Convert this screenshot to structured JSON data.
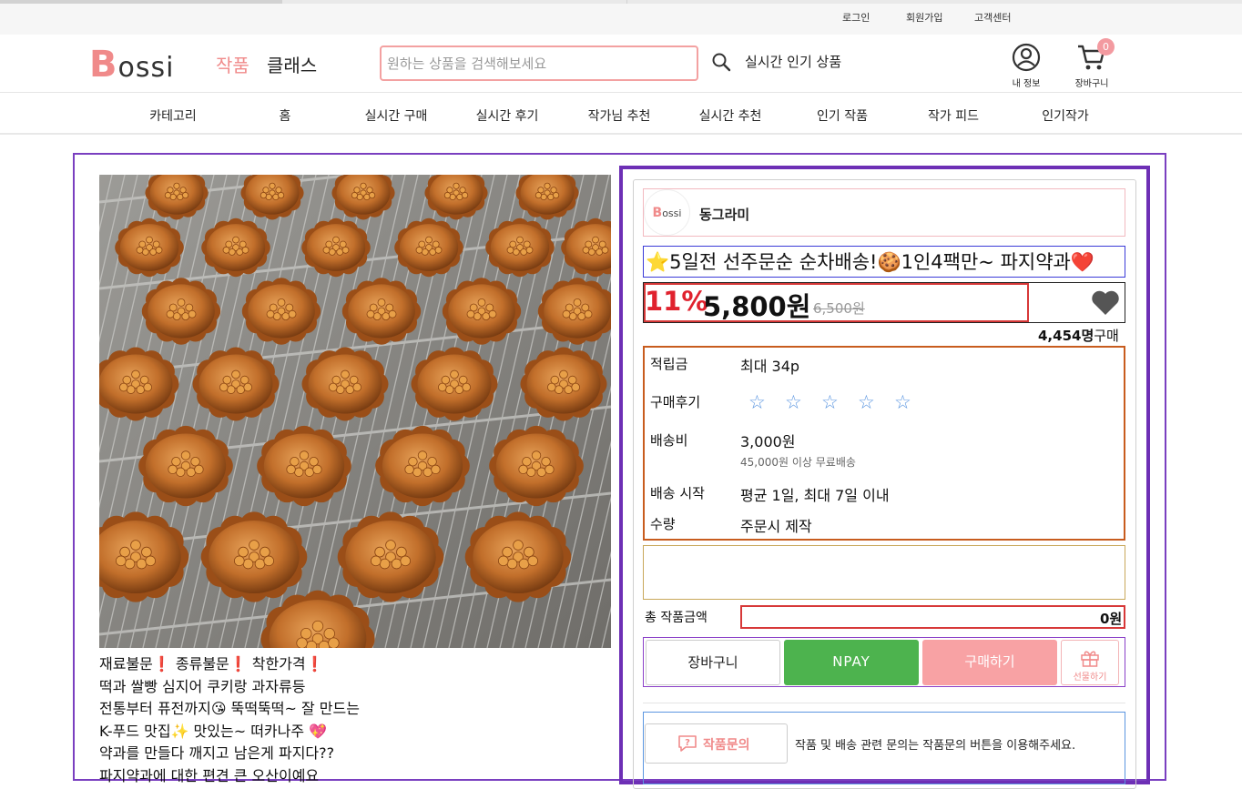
{
  "util_nav": {
    "login": "로그인",
    "signup": "회원가입",
    "support": "고객센터"
  },
  "header": {
    "logo_b": "B",
    "logo_rest": "ossi",
    "tab_works": "작품",
    "tab_class": "클래스",
    "search_placeholder": "원하는 상품을 검색해보세요",
    "popular_label": "실시간 인기 상품",
    "my_info": "내 정보",
    "cart": "장바구니",
    "cart_count": "0"
  },
  "categories": [
    "카테고리",
    "홈",
    "실시간 구매",
    "실시간 후기",
    "작가님 추천",
    "실시간 추천",
    "인기 작품",
    "작가 피드",
    "인기작가"
  ],
  "product": {
    "seller_avatar_b": "B",
    "seller_avatar_rest": "ossi",
    "seller_name": "동그라미",
    "title": "⭐5일전 선주문순 순차배송!🍪1인4팩만~ 파지약과❤️",
    "discount": "11%",
    "price": "5,800원",
    "original_price": "6,500원",
    "buyers_count": "4,454명",
    "buyers_suffix": "구매",
    "info": {
      "points_label": "적립금",
      "points_value": "최대 34p",
      "review_label": "구매후기",
      "stars": [
        "☆",
        "☆",
        "☆",
        "☆",
        "☆"
      ],
      "shipping_label": "배송비",
      "shipping_value": "3,000원",
      "shipping_note": "45,000원 이상 무료배송",
      "ship_start_label": "배송 시작",
      "ship_start_value": "평균 1일, 최대 7일 이내",
      "qty_label": "수량",
      "qty_value": "주문시 제작"
    },
    "total_label": "총 작품금액",
    "total_value": "0원",
    "buttons": {
      "cart": "장바구니",
      "npay": "NPAY",
      "buy": "구매하기",
      "gift": "선물하기"
    },
    "inquiry_button": "작품문의",
    "inquiry_text": "작품 및 배송 관련 문의는 작품문의 버튼을 이용해주세요."
  },
  "description": [
    "재료불문❗ 종류불문❗ 착한가격❗",
    "떡과 쌀빵 심지어 쿠키랑 과자류등",
    "전통부터 퓨전까지😘 뚝떡뚝떡~ 잘 만드는",
    "K-푸드 맛집✨ 맛있는~ 떠카나주 💖",
    "약과를 만들다 깨지고 남은게 파지다??",
    "파지약과에 대한 편견 큰 오산이예요"
  ],
  "colors": {
    "brand_pink": "#f08a8a",
    "discount_red": "#e0222e",
    "npay_green": "#4db34e",
    "buy_pink": "#f8a2a4",
    "frame_purple": "#6d2fb5"
  }
}
